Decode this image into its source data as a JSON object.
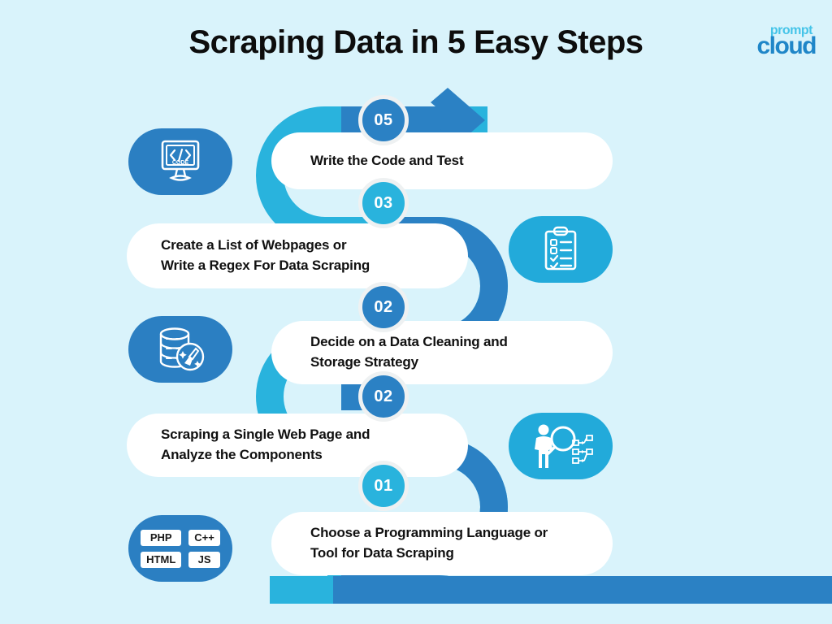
{
  "page": {
    "title": "Scraping Data in 5 Easy Steps",
    "background_color": "#d9f3fb"
  },
  "logo": {
    "name": "promptcloud-logo",
    "top_word": "prompt",
    "bottom_word": "cloud",
    "top_color": "#45c4e8",
    "bottom_color": "#1f86c8"
  },
  "theme": {
    "ribbon_light": "#29b3dd",
    "ribbon_dark": "#2b81c4",
    "card_bg": "#ffffff",
    "text_color": "#111111",
    "badge_ring": "#eef1f2"
  },
  "steps": [
    {
      "number": "05",
      "badge_color": "dark",
      "side": "right",
      "text": "Write the Code and Test",
      "icon": {
        "name": "monitor-code-icon",
        "tile_color": "dark",
        "side": "left",
        "caption": "CODE",
        "symbol": "</>"
      }
    },
    {
      "number": "03",
      "badge_color": "lite",
      "side": "left",
      "text": "Create a List of Webpages or\nWrite a Regex For Data Scraping",
      "icon": {
        "name": "clipboard-checklist-icon",
        "tile_color": "lite",
        "side": "right"
      }
    },
    {
      "number": "02",
      "badge_color": "dark",
      "side": "right",
      "text": "Decide on a Data Cleaning and\nStorage Strategy",
      "icon": {
        "name": "database-cleaning-icon",
        "tile_color": "dark",
        "side": "left"
      }
    },
    {
      "number": "02",
      "badge_color": "dark",
      "side": "left",
      "text": "Scraping a Single Web Page and\nAnalyze the Components",
      "icon": {
        "name": "person-magnifier-flowchart-icon",
        "tile_color": "lite",
        "side": "right"
      }
    },
    {
      "number": "01",
      "badge_color": "lite",
      "side": "right",
      "text": "Choose a Programming Language or\nTool for Data Scraping",
      "icon": {
        "name": "programming-languages-icon",
        "tile_color": "dark",
        "side": "left",
        "chips": [
          "PHP",
          "C++",
          "HTML",
          "JS"
        ]
      }
    }
  ]
}
